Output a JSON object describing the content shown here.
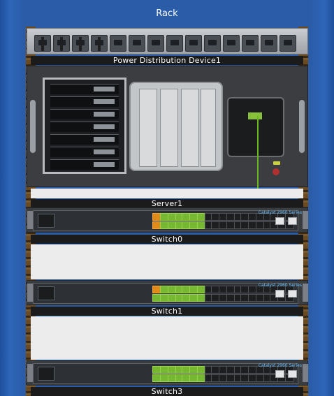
{
  "window": {
    "title": "Rack"
  },
  "devices": [
    {
      "id": "pdu",
      "label": "Power Distribution Device1",
      "outlets": 14,
      "plugged": 4
    },
    {
      "id": "server",
      "label": "Server1"
    },
    {
      "id": "switch0",
      "label": "Switch0",
      "brand": "Catalyst 2960 Series"
    },
    {
      "id": "switch1",
      "label": "Switch1",
      "brand": "Catalyst 2960 Series"
    },
    {
      "id": "switch3",
      "label": "Switch3",
      "brand": "Catalyst 2960 Series"
    }
  ],
  "colors": {
    "rack_blue": "#2a5ca8",
    "link_green": "#6ab820",
    "link_orange": "#e08a1c",
    "label_bg": "#1b1b1b"
  }
}
